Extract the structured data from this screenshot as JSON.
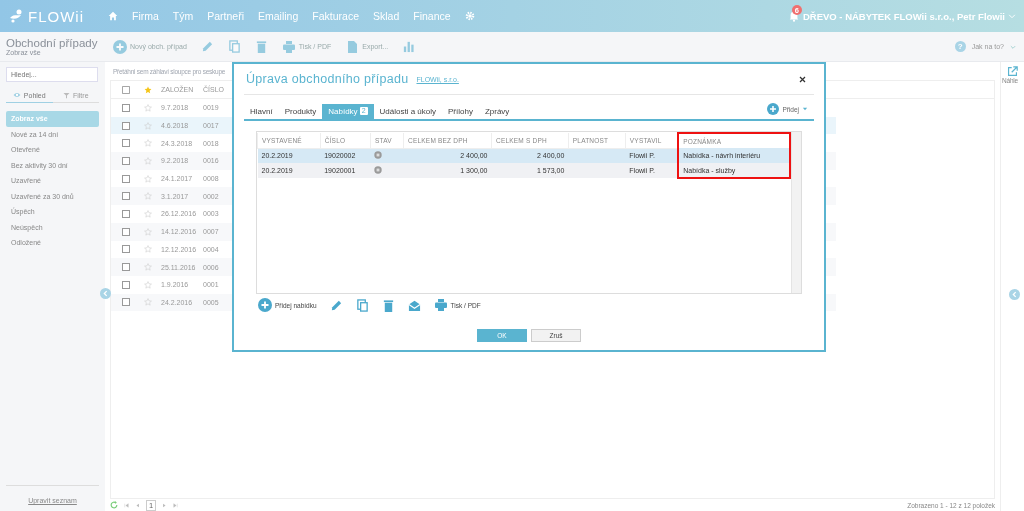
{
  "header": {
    "logo": "FLOWii",
    "nav": [
      "Firma",
      "Tým",
      "Partneři",
      "Emailing",
      "Fakturace",
      "Sklad",
      "Finance"
    ],
    "notification_count": "6",
    "account": "DŘEVO - NÁBYTEK FLOWii s.r.o., Petr Flowii"
  },
  "subheader": {
    "title": "Obchodní případy",
    "subtitle": "Zobraz vše",
    "toolbar": [
      {
        "kind": "add",
        "label": "Nový obch. případ"
      },
      {
        "kind": "edit"
      },
      {
        "kind": "copy"
      },
      {
        "kind": "delete"
      },
      {
        "kind": "print",
        "label": "Tisk / PDF"
      },
      {
        "kind": "export",
        "label": "Export..."
      },
      {
        "kind": "chart"
      }
    ],
    "help_icon": "?",
    "help": "Jak na to?"
  },
  "sidebar": {
    "search": {
      "placeholder": "Hledej..."
    },
    "view_tabs": [
      {
        "label": "Pohled",
        "kind": "view",
        "selected": true
      },
      {
        "label": "Filtre",
        "kind": "filter",
        "selected": false
      }
    ],
    "items": [
      {
        "label": "Zobraz vše",
        "selected": true
      },
      {
        "label": "Nové za 14 dní",
        "selected": false
      },
      {
        "label": "Otevřené",
        "selected": false
      },
      {
        "label": "Bez aktivity 30 dní",
        "selected": false
      },
      {
        "label": "Uzavřené",
        "selected": false
      },
      {
        "label": "Uzavřené za 30 dnů",
        "selected": false
      },
      {
        "label": "Úspěch",
        "selected": false
      },
      {
        "label": "Neúspěch",
        "selected": false
      },
      {
        "label": "Odložené",
        "selected": false
      }
    ],
    "footer_link": "Upravit seznam"
  },
  "list": {
    "group_hint": "Přetáhni sem záhlaví sloupce pro seskupe",
    "columns": [
      "ZALOŽEN",
      "ČÍSLO"
    ],
    "rows": [
      {
        "date": "9.7.2018",
        "number": "0019",
        "checked": false,
        "starred": false,
        "selected": false
      },
      {
        "date": "4.6.2018",
        "number": "0017",
        "checked": false,
        "starred": false,
        "selected": true
      },
      {
        "date": "24.3.2018",
        "number": "0018",
        "checked": false,
        "starred": false,
        "selected": false
      },
      {
        "date": "9.2.2018",
        "number": "0016",
        "checked": false,
        "starred": false,
        "selected": false
      },
      {
        "date": "24.1.2017",
        "number": "0008",
        "checked": false,
        "starred": false,
        "selected": false
      },
      {
        "date": "3.1.2017",
        "number": "0002",
        "checked": false,
        "starred": false,
        "selected": false
      },
      {
        "date": "26.12.2016",
        "number": "0003",
        "checked": false,
        "starred": false,
        "selected": false
      },
      {
        "date": "14.12.2016",
        "number": "0007",
        "checked": false,
        "starred": false,
        "selected": false
      },
      {
        "date": "12.12.2016",
        "number": "0004",
        "checked": false,
        "starred": false,
        "selected": false
      },
      {
        "date": "25.11.2016",
        "number": "0006",
        "checked": false,
        "starred": false,
        "selected": false
      },
      {
        "date": "1.9.2016",
        "number": "0001",
        "checked": false,
        "starred": false,
        "selected": false
      },
      {
        "date": "24.2.2016",
        "number": "0005",
        "checked": false,
        "starred": false,
        "selected": false
      }
    ],
    "pager": {
      "page": "1",
      "summary": "Zobrazeno 1 - 12 z 12 položek"
    }
  },
  "right_panel": {
    "preview_label": "Náhle"
  },
  "modal": {
    "title": "Úprava obchodního případu",
    "company_link": "FLOWii, s.r.o.",
    "tabs": [
      {
        "label": "Hlavní",
        "selected": false
      },
      {
        "label": "Produkty",
        "selected": false
      },
      {
        "label": "Nabídky",
        "badge": "2",
        "selected": true
      },
      {
        "label": "Události a úkoly",
        "selected": false
      },
      {
        "label": "Přílohy",
        "selected": false
      },
      {
        "label": "Zprávy",
        "selected": false
      }
    ],
    "add_menu": "Přidej",
    "table": {
      "columns": [
        {
          "label": "VYSTAVENÉ",
          "kind": "text",
          "highlighted": false
        },
        {
          "label": "ČÍSLO",
          "kind": "text",
          "highlighted": false
        },
        {
          "label": "STAV",
          "kind": "status",
          "highlighted": false
        },
        {
          "label": "CELKEM BEZ DPH",
          "kind": "amount",
          "highlighted": false
        },
        {
          "label": "CELKEM S DPH",
          "kind": "amount",
          "highlighted": false
        },
        {
          "label": "PLATNOST",
          "kind": "text",
          "highlighted": false
        },
        {
          "label": "VYSTAVIL",
          "kind": "text",
          "highlighted": false
        },
        {
          "label": "POZNÁMKA",
          "kind": "text",
          "highlighted": true
        }
      ],
      "rows": [
        {
          "issued": "20.2.2019",
          "number": "19020002",
          "color": "#9a9a9a",
          "total_net": "2 400,00",
          "total_gross": "2 400,00",
          "issued_by": "Flowii P.",
          "note": "Nabídka - návrh interiéru",
          "selected": true
        },
        {
          "issued": "20.2.2019",
          "number": "19020001",
          "color": "#9a9a9a",
          "total_net": "1 300,00",
          "total_gross": "1 573,00",
          "issued_by": "Flowii P.",
          "note": "Nabídka - služby",
          "selected": false
        }
      ]
    },
    "toolbar": [
      {
        "kind": "add",
        "label": "Přidej nabídku"
      },
      {
        "kind": "edit"
      },
      {
        "kind": "copy"
      },
      {
        "kind": "delete"
      },
      {
        "kind": "email"
      },
      {
        "kind": "print",
        "label": "Tisk / PDF"
      }
    ],
    "buttons": [
      {
        "label": "OK",
        "kind": "primary"
      },
      {
        "label": "Zruš",
        "kind": "secondary"
      }
    ]
  }
}
